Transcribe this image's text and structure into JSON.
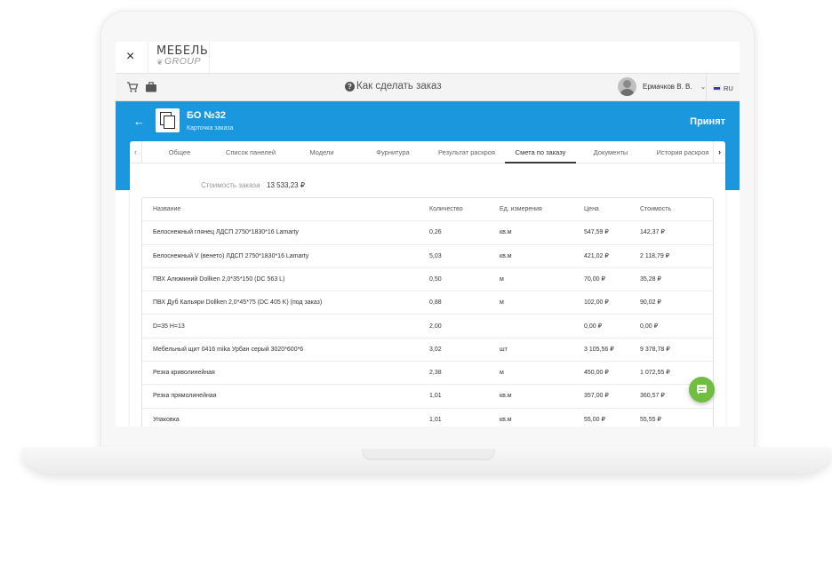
{
  "app": {
    "logo_main": "МЕБЕЛЬ",
    "logo_sub": "GROUP",
    "close_glyph": "×"
  },
  "toolbar": {
    "help_text": "Как сделать заказ",
    "user_name": "Ермачков В. В.",
    "language": "RU",
    "icons": [
      "cart-icon",
      "briefcase-icon",
      "help-icon",
      "chevron-down-icon",
      "flag-ru-icon"
    ]
  },
  "header": {
    "order_title": "БО №32",
    "subtitle": "Карточка заказа",
    "status": "Принят",
    "accent_color": "#1b97de"
  },
  "tabs": [
    {
      "label": "Общее"
    },
    {
      "label": "Список панелей"
    },
    {
      "label": "Модели"
    },
    {
      "label": "Фурнитура"
    },
    {
      "label": "Результат раскроя"
    },
    {
      "label": "Смета по заказу",
      "active": true
    },
    {
      "label": "Документы"
    },
    {
      "label": "История раскроя"
    }
  ],
  "estimate": {
    "total_label": "Стоимость заказа",
    "total_value": "13 533,23 ₽",
    "columns": [
      "Название",
      "Количество",
      "Ед. измерения",
      "Цена",
      "Стоимость"
    ],
    "rows": [
      [
        "Белоснежный глянец ЛДСП 2750*1830*16 Lamarty",
        "0,26",
        "кв.м",
        "547,59 ₽",
        "142,37 ₽"
      ],
      [
        "Белоснежный V (венето) ЛДСП 2750*1830*16 Lamarty",
        "5,03",
        "кв.м",
        "421,02 ₽",
        "2 118,79 ₽"
      ],
      [
        "ПВХ Алюминий Dollken 2,0*35*150 (DC 563 L)",
        "0,50",
        "м",
        "70,00 ₽",
        "35,28 ₽"
      ],
      [
        "ПВХ Дуб Кальяри Dollken 2,0*45*75 (DC 405 K) (под заказ)",
        "0,88",
        "м",
        "102,00 ₽",
        "90,02 ₽"
      ],
      [
        "D=35 H=13",
        "2,00",
        "",
        "0,00 ₽",
        "0,00 ₽"
      ],
      [
        "Мебельный щит 0416 mika Урбан серый 3020*600*6",
        "3,02",
        "шт",
        "3 105,56 ₽",
        "9 378,78 ₽"
      ],
      [
        "Резка криволинейная",
        "2,38",
        "м",
        "450,00 ₽",
        "1 072,55 ₽"
      ],
      [
        "Резка прямолинейная",
        "1,01",
        "кв.м",
        "357,00 ₽",
        "360,57 ₽"
      ],
      [
        "Упаковка",
        "1,01",
        "кв.м",
        "55,00 ₽",
        "55,55 ₽"
      ]
    ]
  },
  "chat": {
    "icon": "chat-icon",
    "color": "#6fbe3f"
  }
}
